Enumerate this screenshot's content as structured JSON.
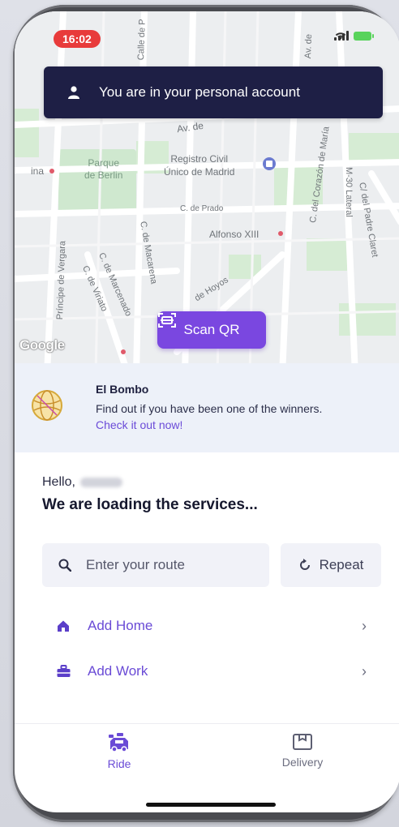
{
  "status_bar": {
    "time": "16:02"
  },
  "map": {
    "labels": {
      "parque_berlin": "Parque\nde Berlin",
      "registro_civil": "Registro Civil\nÚnico de Madrid",
      "c_de_prado": "C. de Prado",
      "alfonso_xiii": "Alfonso XIII",
      "av_de": "Av. de",
      "m30": "M-30 Lateral",
      "c_padre_claret": "C/ del Padre Claret",
      "c_corazon": "C. del Corazón de María",
      "c_macarena": "C. de Macarena",
      "c_marcenado": "C. de Marcenado",
      "c_viriato": "C. de Viriato",
      "c_vergara": "Príncipe de Vergara",
      "hoyos": "de Hoyos",
      "ina": "ina",
      "av_sm": "Av. de",
      "calle_p": "Calle de P",
      "google": "Google"
    }
  },
  "account_banner": {
    "text": "You are in your personal account",
    "icon": "person-icon"
  },
  "scan_qr": {
    "label": "Scan QR",
    "icon": "qr-scan-icon"
  },
  "promo": {
    "title": "El Bombo",
    "description": "Find out if you have been one of the winners.",
    "link": "Check it out now!"
  },
  "greeting": {
    "hello": "Hello,"
  },
  "loading_title": "We are loading the services...",
  "route": {
    "placeholder": "Enter your route",
    "repeat_label": "Repeat"
  },
  "places": [
    {
      "label": "Add Home",
      "icon": "home-icon"
    },
    {
      "label": "Add Work",
      "icon": "briefcase-icon"
    }
  ],
  "bottom_nav": [
    {
      "label": "Ride",
      "icon": "car-icon",
      "active": true
    },
    {
      "label": "Delivery",
      "icon": "box-icon",
      "active": false
    }
  ],
  "colors": {
    "accent": "#7a47e0",
    "banner_bg": "#1e1f45",
    "time_pill": "#e83b3b",
    "promo_bg": "#edf1f9"
  }
}
